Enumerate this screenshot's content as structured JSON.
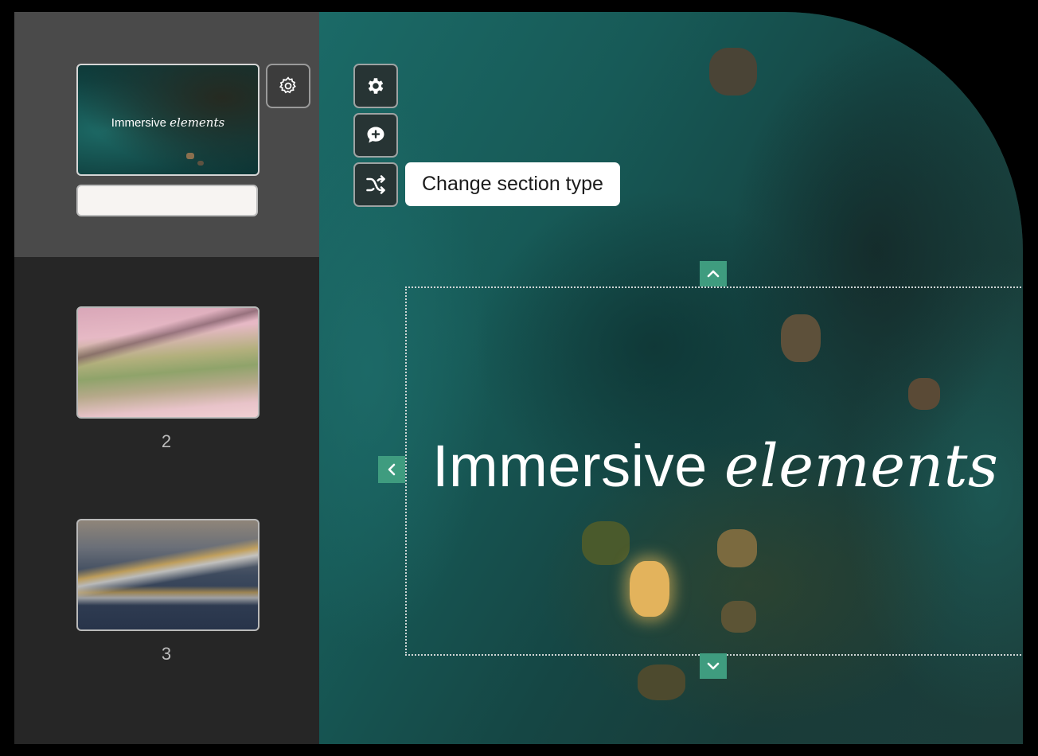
{
  "sidebar": {
    "slides": [
      {
        "title_regular": "Immersive ",
        "title_italic": "elements",
        "number": ""
      },
      {
        "number": "2"
      },
      {
        "number": "3"
      }
    ],
    "rename_field_value": ""
  },
  "canvas": {
    "tooltip": "Change section type",
    "headline_regular": "Immersive ",
    "headline_italic": "elements",
    "tools": [
      "gear-icon",
      "comment-add-icon",
      "shuffle-icon"
    ]
  },
  "colors": {
    "sidebar_active": "#4a4a4a",
    "sidebar_bg": "#262626",
    "handle_accent": "#3f9c7f",
    "tooltip_bg": "#ffffff"
  }
}
